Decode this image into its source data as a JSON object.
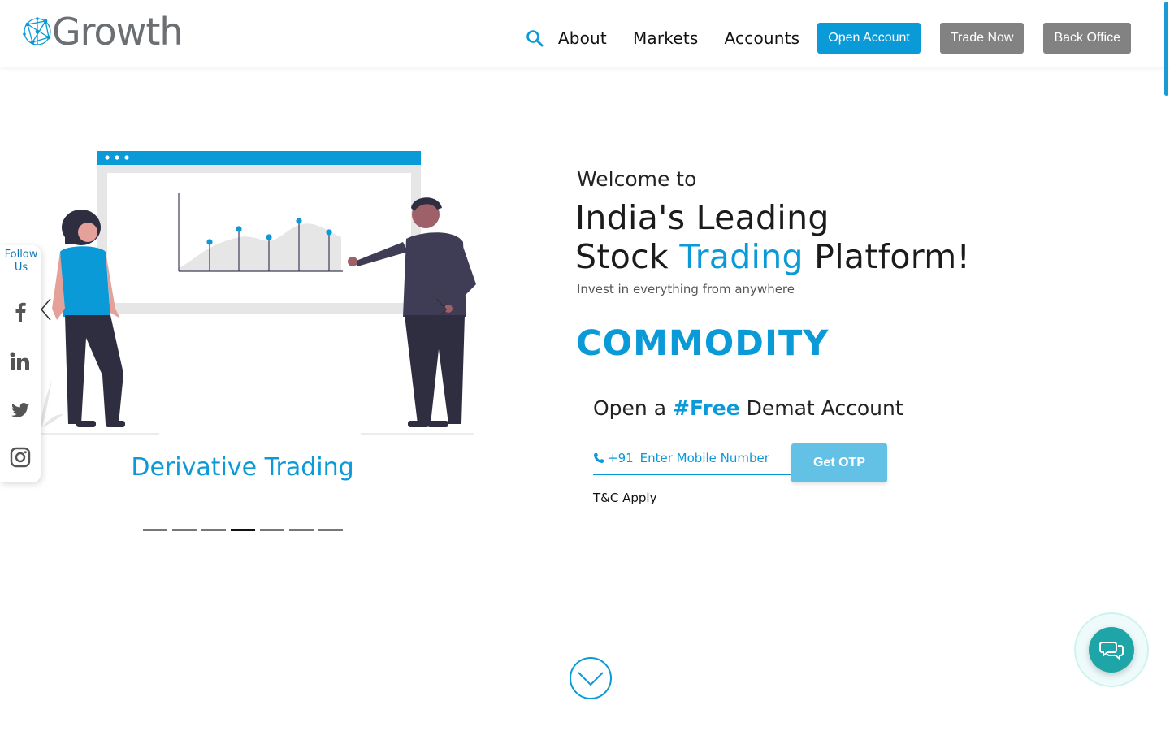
{
  "brand": {
    "name": "Growth",
    "color": "#0a9ad8"
  },
  "nav": {
    "links": [
      "About",
      "Markets",
      "Accounts"
    ],
    "buttons": {
      "open_account": "Open Account",
      "trade_now": "Trade Now",
      "back_office": "Back Office"
    }
  },
  "follow": {
    "label_line1": "Follow",
    "label_line2": "Us",
    "icons": [
      "facebook-icon",
      "linkedin-icon",
      "twitter-icon",
      "instagram-icon"
    ]
  },
  "carousel": {
    "caption": "Derivative Trading",
    "slide_count": 7,
    "active_index": 3
  },
  "hero": {
    "welcome": "Welcome to",
    "line1": "India's Leading",
    "line2_pre": "Stock ",
    "line2_highlight": "Trading",
    "line2_post": " Platform!",
    "subtext": "Invest in everything from anywhere",
    "rotating_word": "COMMODITY"
  },
  "demat": {
    "title_pre": "Open a ",
    "title_highlight": "#Free",
    "title_post": " Demat Account",
    "prefix": "+91",
    "placeholder": "Enter Mobile Number",
    "otp_button": "Get OTP",
    "tnc": "T&C Apply"
  }
}
